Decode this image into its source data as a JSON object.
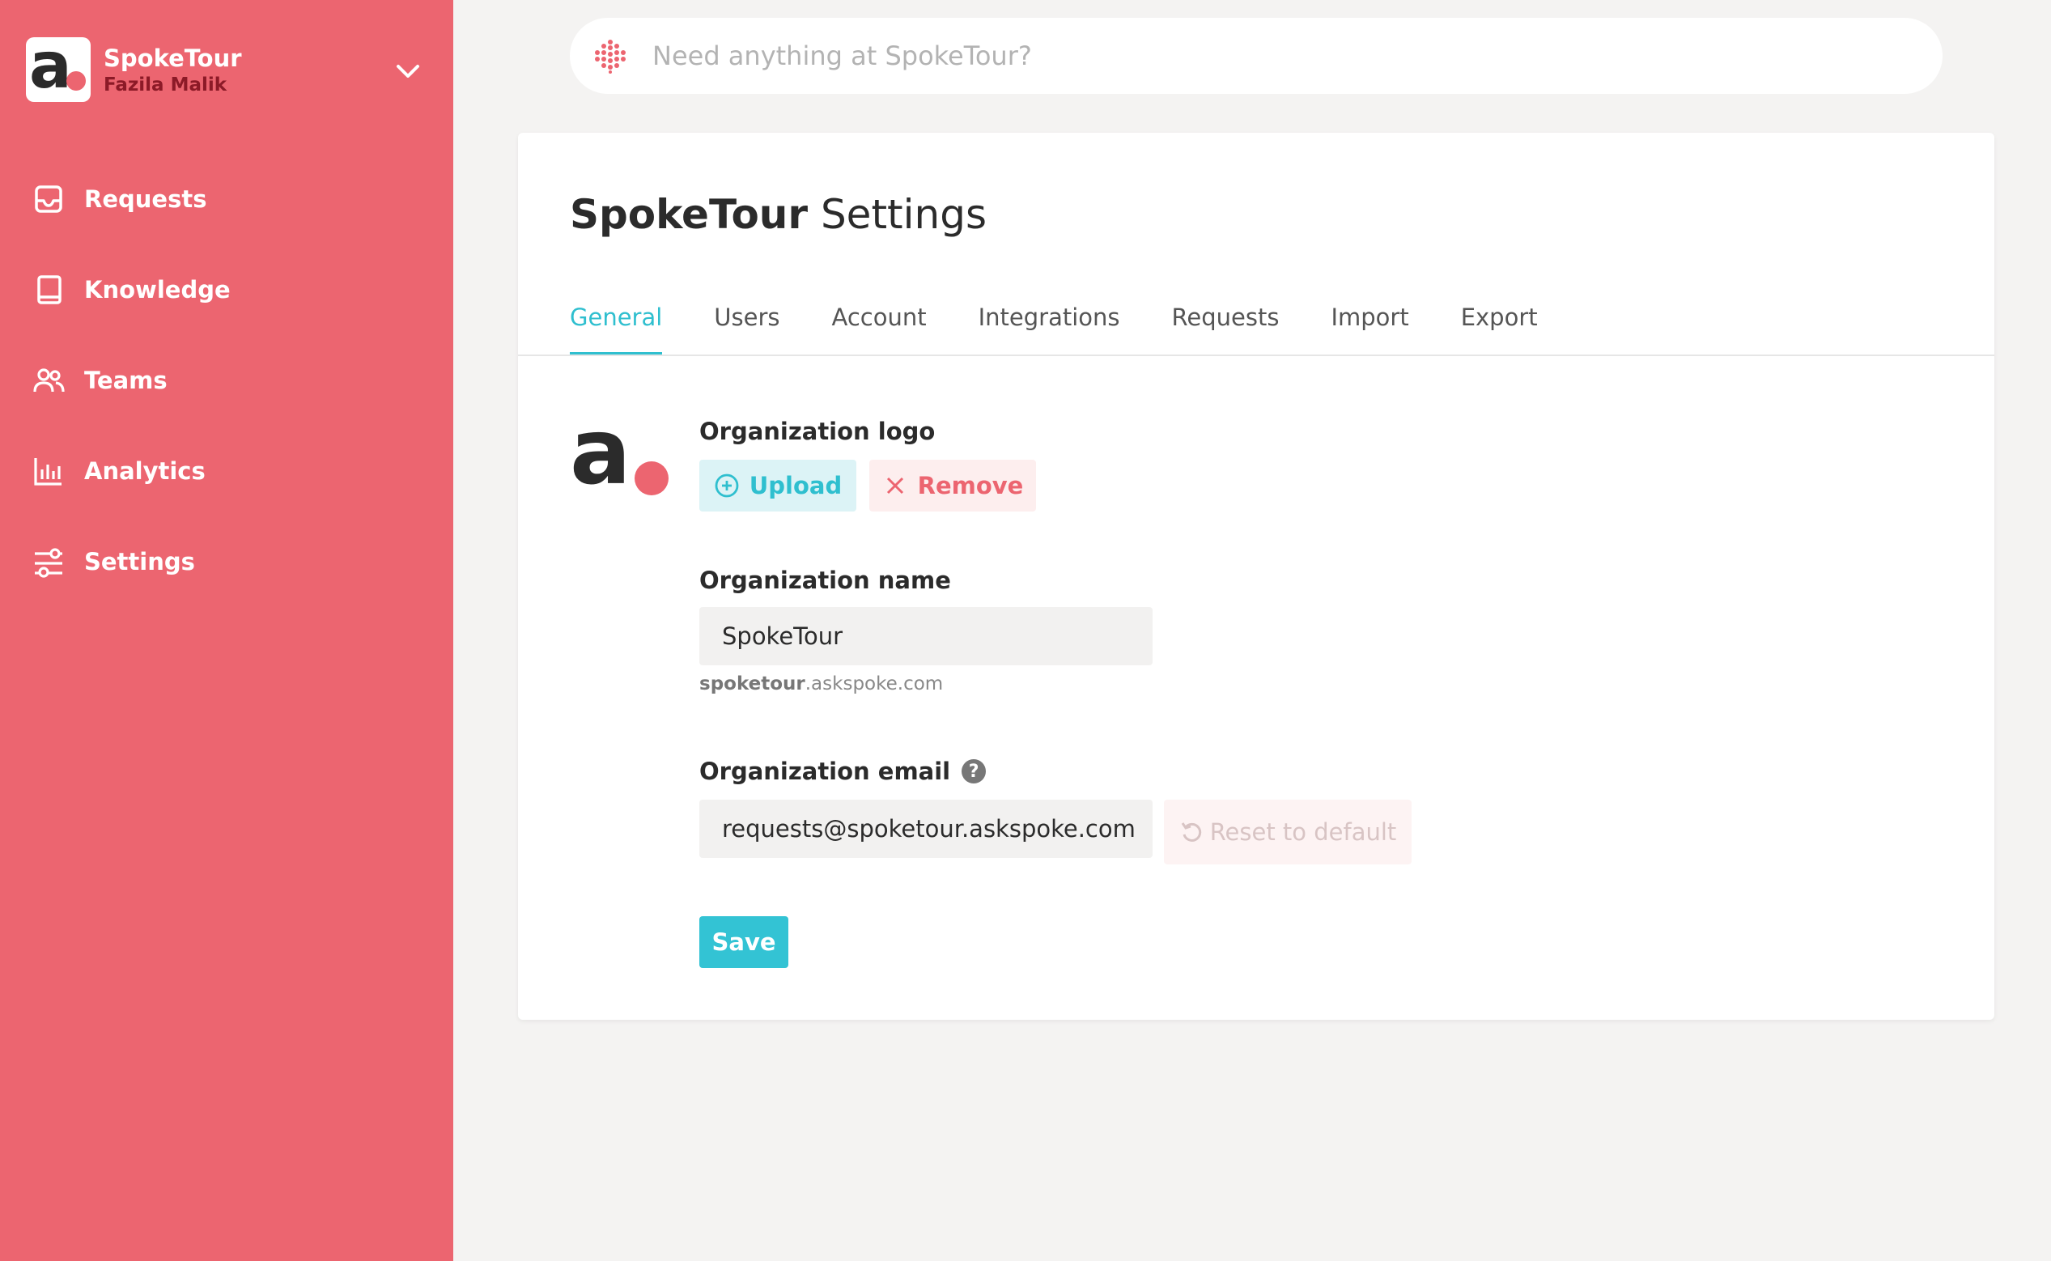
{
  "sidebar": {
    "org_name": "SpokeTour",
    "user_name": "Fazila Malik",
    "logo_letter": "a",
    "items": [
      {
        "label": "Requests",
        "icon": "inbox-icon"
      },
      {
        "label": "Knowledge",
        "icon": "book-icon"
      },
      {
        "label": "Teams",
        "icon": "users-icon"
      },
      {
        "label": "Analytics",
        "icon": "bar-chart-icon"
      },
      {
        "label": "Settings",
        "icon": "sliders-icon"
      }
    ]
  },
  "search": {
    "placeholder": "Need anything at SpokeTour?"
  },
  "settings": {
    "title_brand": "SpokeTour",
    "title_rest": " Settings",
    "tabs": [
      "General",
      "Users",
      "Account",
      "Integrations",
      "Requests",
      "Import",
      "Export"
    ],
    "active_tab": "General",
    "logo_label": "Organization logo",
    "logo_letter": "a",
    "upload_label": "Upload",
    "remove_label": "Remove",
    "name_label": "Organization name",
    "name_value": "SpokeTour",
    "subdomain_prefix": "spoketour",
    "subdomain_suffix": ".askspoke.com",
    "email_label": "Organization email",
    "help_glyph": "?",
    "email_value": "requests@spoketour.askspoke.com",
    "reset_label": "Reset to default",
    "save_label": "Save"
  },
  "colors": {
    "sidebar": "#ec6570",
    "accent": "#33c3d4",
    "danger": "#ec6570",
    "background": "#f4f3f2"
  }
}
